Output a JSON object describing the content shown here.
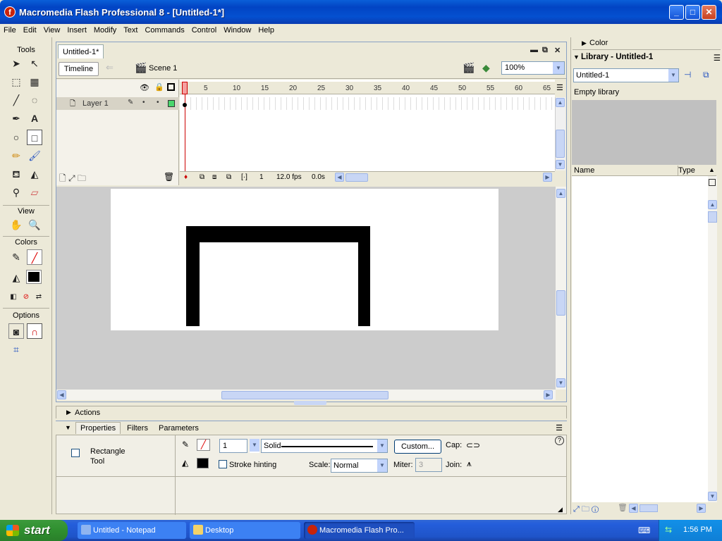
{
  "window": {
    "title": "Macromedia Flash Professional 8 - [Untitled-1*]"
  },
  "menu": [
    "File",
    "Edit",
    "View",
    "Insert",
    "Modify",
    "Text",
    "Commands",
    "Control",
    "Window",
    "Help"
  ],
  "tools": {
    "header": "Tools",
    "view_label": "View",
    "colors_label": "Colors",
    "options_label": "Options"
  },
  "document": {
    "tab_label": "Untitled-1*",
    "timeline_button": "Timeline",
    "scene_label": "Scene 1",
    "zoom": "100%"
  },
  "timeline": {
    "frame_numbers": [
      "1",
      "5",
      "10",
      "15",
      "20",
      "25",
      "30",
      "35",
      "40",
      "45",
      "50",
      "55",
      "60",
      "65"
    ],
    "layer_name": "Layer 1",
    "current_frame": "1",
    "fps": "12.0 fps",
    "elapsed": "0.0s"
  },
  "panels": {
    "actions_label": "Actions",
    "tabs": [
      "Properties",
      "Filters",
      "Parameters"
    ]
  },
  "properties": {
    "tool_name_line1": "Rectangle",
    "tool_name_line2": "Tool",
    "stroke_height": "1",
    "stroke_style": "Solid",
    "custom_label": "Custom...",
    "cap_label": "Cap:",
    "stroke_hinting_label": "Stroke hinting",
    "scale_label": "Scale:",
    "scale_value": "Normal",
    "miter_label": "Miter:",
    "miter_value": "3",
    "join_label": "Join:"
  },
  "library": {
    "color_header": "Color",
    "header": "Library - Untitled-1",
    "selected_doc": "Untitled-1",
    "empty_text": "Empty library",
    "col_name": "Name",
    "col_type": "Type"
  },
  "taskbar": {
    "start": "start",
    "items": [
      "Untitled - Notepad",
      "Desktop",
      "Macromedia Flash Pro..."
    ],
    "clock": "1:56 PM"
  }
}
